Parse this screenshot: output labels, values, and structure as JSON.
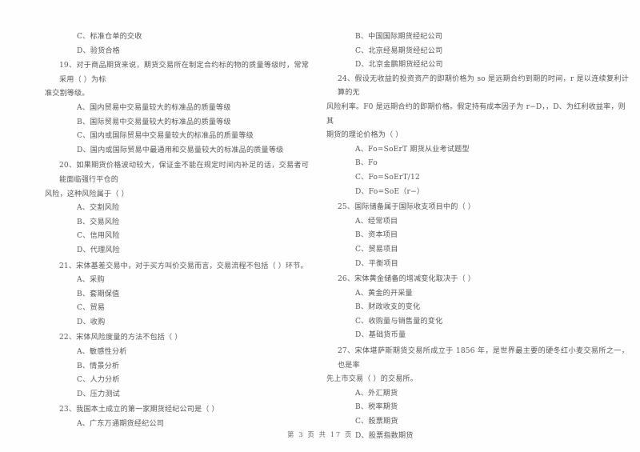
{
  "document": {
    "footer": "第 3 页  共 17 页"
  },
  "left_column": {
    "orphan_options": [
      "C、标准仓单的交收",
      "D、验货合格"
    ],
    "questions": [
      {
        "number": "19",
        "stem_line1": "19、对于商品期货来说，期货交易所在制定合约标的物的质量等级时，常常采用（        ）为标",
        "stem_line2": "准交割等级。",
        "options": [
          "A、国内贸易中交易量较大的标准品的质量等级",
          "B、国际贸易中交易量较大的标准品的质量等级",
          "C、国内或国际贸易中交易量较大的标准品的质量等级",
          "D、国内或国际贸易中最通用和交易量较大的标准品的质量等级"
        ]
      },
      {
        "number": "20",
        "stem_line1": "20、如果期货价格波动较大，保证金不能在规定时间内补足的话，交易者可能面临强行平仓的",
        "stem_line2": "风险，这种风险属于（        ）",
        "options": [
          "A、交割风险",
          "B、交易风险",
          "C、信用风险",
          "D、代理风险"
        ]
      },
      {
        "number": "21",
        "stem_line1": "21、宋体基差交易中，对于买方叫价交易而言，交易流程不包括（        ）环节。",
        "stem_line2": "",
        "options": [
          "A、采购",
          "B、套期保值",
          "C、贸易",
          "D、收购"
        ]
      },
      {
        "number": "22",
        "stem_line1": "22、宋体风险度量的方法不包括（        ）",
        "stem_line2": "",
        "options": [
          "A、敏感性分析",
          "B、情景分析",
          "C、人力分析",
          "D、压力测试"
        ]
      },
      {
        "number": "23",
        "stem_line1": "23、我国本土成立的第一家期货经纪公司是（        ）",
        "stem_line2": "",
        "options": [
          "A、广东万通期货经纪公司"
        ]
      }
    ]
  },
  "right_column": {
    "orphan_options": [
      "B、中国国际期货经纪公司",
      "C、北京经易期货经纪公司",
      "D、北京金鹏期货经纪公司"
    ],
    "questions": [
      {
        "number": "24",
        "stem_line1": "24、假设无收益的投资资产的即期价格为 so 是远期合约到期的时间，r 是以连续复利计算的无",
        "stem_line2": "风险利率。F0 是远期合约的即期价格。假定持有成本因子为 r−D，，D、为红利收益率，则其",
        "stem_line3": "期货的理论价格为（        ）",
        "options": [
          "A、Fo=SoErT 期货从业考试题型",
          "B、Fo",
          "C、Fo=SoErT/12",
          "D、Fo=SoE（r−）"
        ]
      },
      {
        "number": "25",
        "stem_line1": "25、国际储备属于国际收支项目中的（        ）",
        "stem_line2": "",
        "options": [
          "A、经常项目",
          "B、资本项目",
          "C、贸易项目",
          "D、平衡项目"
        ]
      },
      {
        "number": "26",
        "stem_line1": "26、宋体黄金储备的增减变化取决于（        ）",
        "stem_line2": "",
        "options": [
          "A、黄金的开采量",
          "B、财政收支的变化",
          "C、收购量与销售量的变化",
          "D、基础货币量"
        ]
      },
      {
        "number": "27",
        "stem_line1": "27、宋体堪萨斯期货交易所成立于 1856 年，是世界最主要的硬冬红小麦交易所之一，也是率",
        "stem_line2": "先上市交易（        ）的交易所。",
        "options": [
          "A、外汇期货",
          "B、税率期货",
          "C、股票期货",
          "D、股票指数期货"
        ]
      }
    ]
  }
}
